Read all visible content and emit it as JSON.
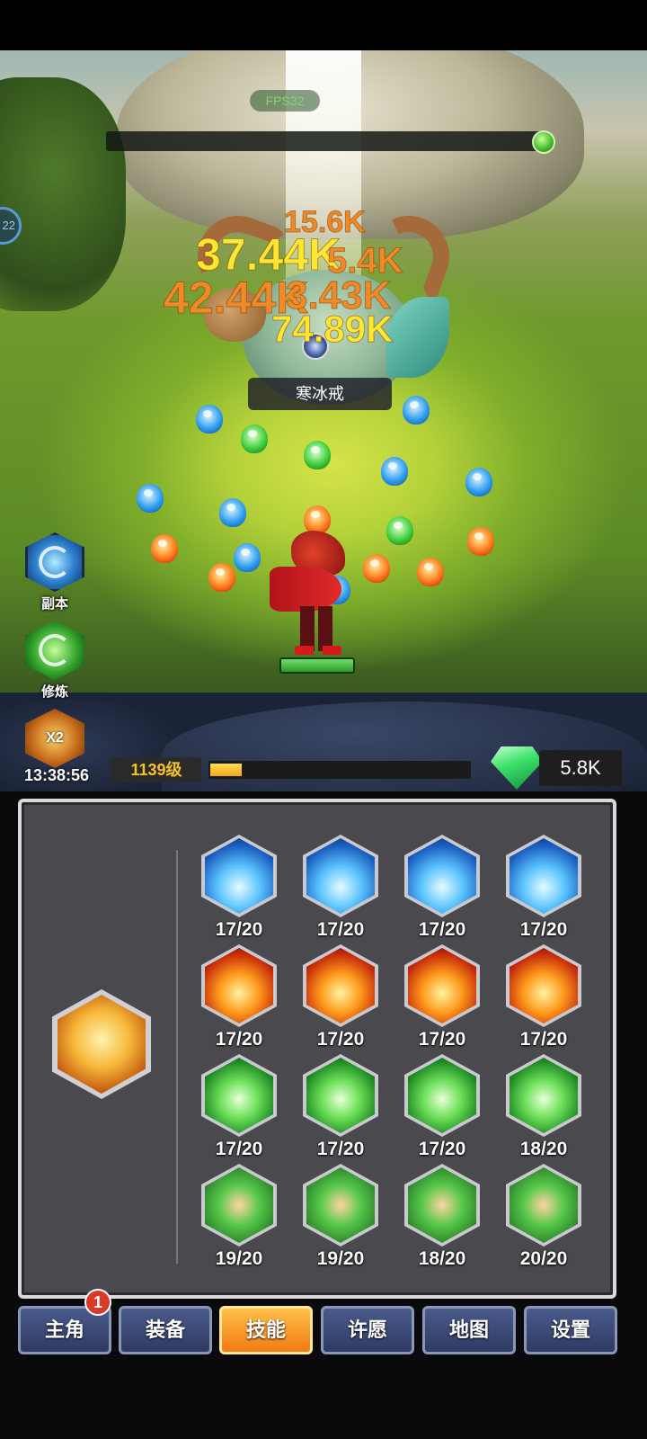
{
  "hud": {
    "fps_label": "FPS32",
    "side_counter": "22",
    "item_label": "寒冰戒",
    "timer": "13:38:56",
    "level": "1139级",
    "exp_progress": 0.12,
    "gems": "5.8K"
  },
  "damage_numbers": [
    "15.6K",
    "37.44K",
    "5.4K",
    "42.44K",
    "3.43K",
    "74.89K"
  ],
  "side_menu": [
    {
      "label": "副本",
      "icon": "vortex-icon"
    },
    {
      "label": "修炼",
      "icon": "spiral-icon"
    },
    {
      "label": "",
      "badge": "X2",
      "icon": "double-speed-icon"
    }
  ],
  "skills": {
    "rows": [
      {
        "element": "ice",
        "levels": [
          "17/20",
          "17/20",
          "17/20",
          "17/20"
        ]
      },
      {
        "element": "fire",
        "levels": [
          "17/20",
          "17/20",
          "17/20",
          "17/20"
        ]
      },
      {
        "element": "wind",
        "levels": [
          "17/20",
          "17/20",
          "17/20",
          "18/20"
        ]
      },
      {
        "element": "mixed",
        "levels": [
          "19/20",
          "19/20",
          "18/20",
          "20/20"
        ]
      }
    ]
  },
  "tabs": [
    {
      "label": "主角",
      "badge": "1"
    },
    {
      "label": "装备"
    },
    {
      "label": "技能",
      "active": true
    },
    {
      "label": "许愿"
    },
    {
      "label": "地图"
    },
    {
      "label": "设置"
    }
  ],
  "colors": {
    "active_tab": "#f27a12",
    "tab": "#2e3a62",
    "level_text": "#f5c22a"
  }
}
